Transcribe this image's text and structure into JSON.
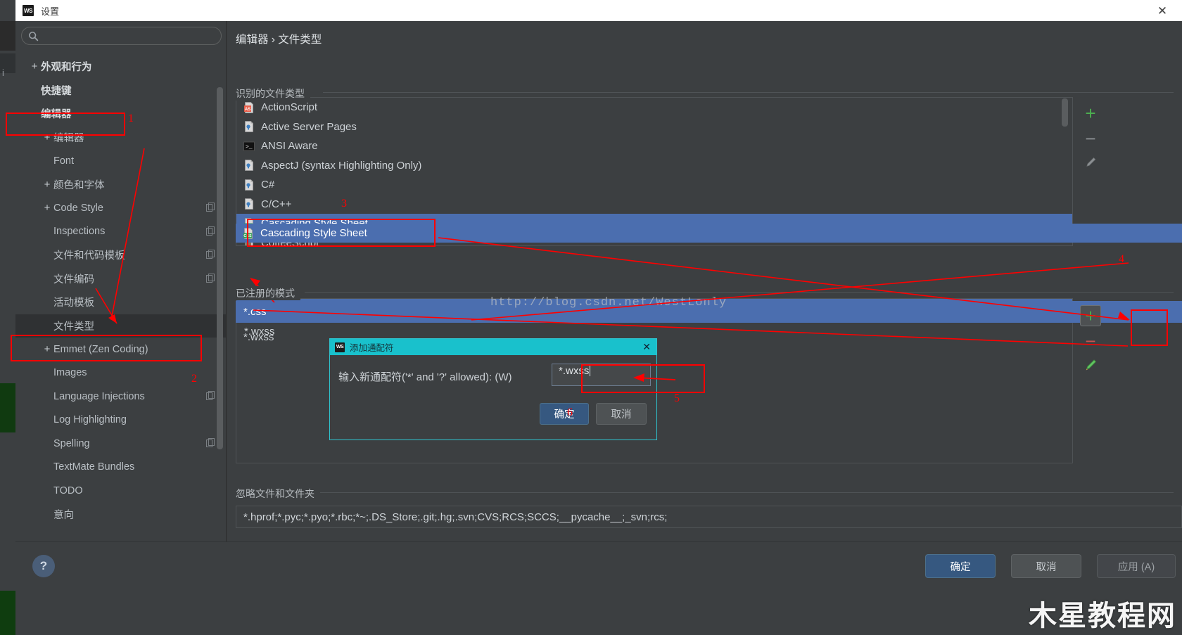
{
  "window": {
    "title": "设置",
    "logo_text": "WS",
    "close_label": "✕"
  },
  "sidebar": {
    "search_placeholder": "",
    "search_value": "",
    "search_icon": "search-icon",
    "items": [
      {
        "label": "外观和行为",
        "toggle": "+",
        "level": 0,
        "selected": false,
        "copy": false
      },
      {
        "label": "快捷键",
        "toggle": "",
        "level": 0,
        "selected": false,
        "copy": false
      },
      {
        "label": "编辑器",
        "toggle": "−",
        "level": 0,
        "selected": false,
        "copy": false
      },
      {
        "label": "编辑器",
        "toggle": "+",
        "level": 1,
        "selected": false,
        "copy": false
      },
      {
        "label": "Font",
        "toggle": "",
        "level": 1,
        "selected": false,
        "copy": false
      },
      {
        "label": "颜色和字体",
        "toggle": "+",
        "level": 1,
        "selected": false,
        "copy": false
      },
      {
        "label": "Code Style",
        "toggle": "+",
        "level": 1,
        "selected": false,
        "copy": true
      },
      {
        "label": "Inspections",
        "toggle": "",
        "level": 1,
        "selected": false,
        "copy": true
      },
      {
        "label": "文件和代码模板",
        "toggle": "",
        "level": 1,
        "selected": false,
        "copy": true
      },
      {
        "label": "文件编码",
        "toggle": "",
        "level": 1,
        "selected": false,
        "copy": true
      },
      {
        "label": "活动模板",
        "toggle": "",
        "level": 1,
        "selected": false,
        "copy": false
      },
      {
        "label": "文件类型",
        "toggle": "",
        "level": 1,
        "selected": true,
        "copy": false
      },
      {
        "label": "Emmet (Zen Coding)",
        "toggle": "+",
        "level": 1,
        "selected": false,
        "copy": false
      },
      {
        "label": "Images",
        "toggle": "",
        "level": 1,
        "selected": false,
        "copy": false
      },
      {
        "label": "Language Injections",
        "toggle": "",
        "level": 1,
        "selected": false,
        "copy": true
      },
      {
        "label": "Log Highlighting",
        "toggle": "",
        "level": 1,
        "selected": false,
        "copy": false
      },
      {
        "label": "Spelling",
        "toggle": "",
        "level": 1,
        "selected": false,
        "copy": true
      },
      {
        "label": "TextMate Bundles",
        "toggle": "",
        "level": 1,
        "selected": false,
        "copy": false
      },
      {
        "label": "TODO",
        "toggle": "",
        "level": 1,
        "selected": false,
        "copy": false
      },
      {
        "label": "意向",
        "toggle": "",
        "level": 1,
        "selected": false,
        "copy": false
      }
    ]
  },
  "main": {
    "breadcrumb": "编辑器 › 文件类型",
    "recognized_section_title": "识别的文件类型",
    "file_types": [
      {
        "name": "ActionScript",
        "icon": "as-file-icon",
        "selected": false
      },
      {
        "name": "Active Server Pages",
        "icon": "generic-file-icon",
        "selected": false
      },
      {
        "name": "ANSI Aware",
        "icon": "terminal-icon",
        "selected": false
      },
      {
        "name": "AspectJ (syntax Highlighting Only)",
        "icon": "generic-file-icon",
        "selected": false
      },
      {
        "name": "C#",
        "icon": "generic-file-icon",
        "selected": false
      },
      {
        "name": "C/C++",
        "icon": "generic-file-icon",
        "selected": false
      },
      {
        "name": "Cascading Style Sheet",
        "icon": "css-file-icon",
        "selected": true
      },
      {
        "name": "CoffeeScript",
        "icon": "coffee-file-icon",
        "selected": false
      }
    ],
    "patterns_section_title": "已注册的模式",
    "patterns": [
      {
        "value": "*.css",
        "selected": true
      },
      {
        "value": "*.wxss",
        "selected": false
      }
    ],
    "ignore_section_title": "忽略文件和文件夹",
    "ignore_value": "*.hprof;*.pyc;*.pyo;*.rbc;*~;.DS_Store;.git;.hg;.svn;CVS;RCS;SCCS;__pycache__;_svn;rcs;",
    "toolbar_top": [
      {
        "icon": "plus-icon",
        "label": "+"
      },
      {
        "icon": "minus-icon",
        "label": "−"
      },
      {
        "icon": "pencil-icon",
        "label": "✏"
      }
    ],
    "toolbar_bottom": [
      {
        "icon": "plus-icon",
        "label": "+"
      },
      {
        "icon": "minus-icon",
        "label": "−"
      },
      {
        "icon": "pencil-icon",
        "label": "✏"
      }
    ]
  },
  "dialog": {
    "logo_text": "WS",
    "title": "添加通配符",
    "close_label": "✕",
    "label": "输入新通配符('*' and '?' allowed): (W)",
    "input_value": "*.wxss",
    "ok_label": "确定",
    "cancel_label": "取消"
  },
  "footer": {
    "help_label": "?",
    "ok_label": "确定",
    "cancel_label": "取消",
    "apply_label": "应用 (A)"
  },
  "annotations": {
    "numbers": [
      "1",
      "2",
      "3",
      "4",
      "5",
      "6"
    ],
    "color": "#ff0000"
  },
  "watermarks": {
    "url": "http://blog.csdn.net/WestLonly",
    "site": "木星教程网"
  },
  "colors": {
    "window_bg": "#3c3f41",
    "titlebar_bg": "#ffffff",
    "selection_blue": "#4b6eaf",
    "dialog_accent": "#19c1cc",
    "primary_button": "#365880",
    "annotation_red": "#ff0000",
    "add_green": "#4caf50",
    "remove_red": "#c75450"
  }
}
